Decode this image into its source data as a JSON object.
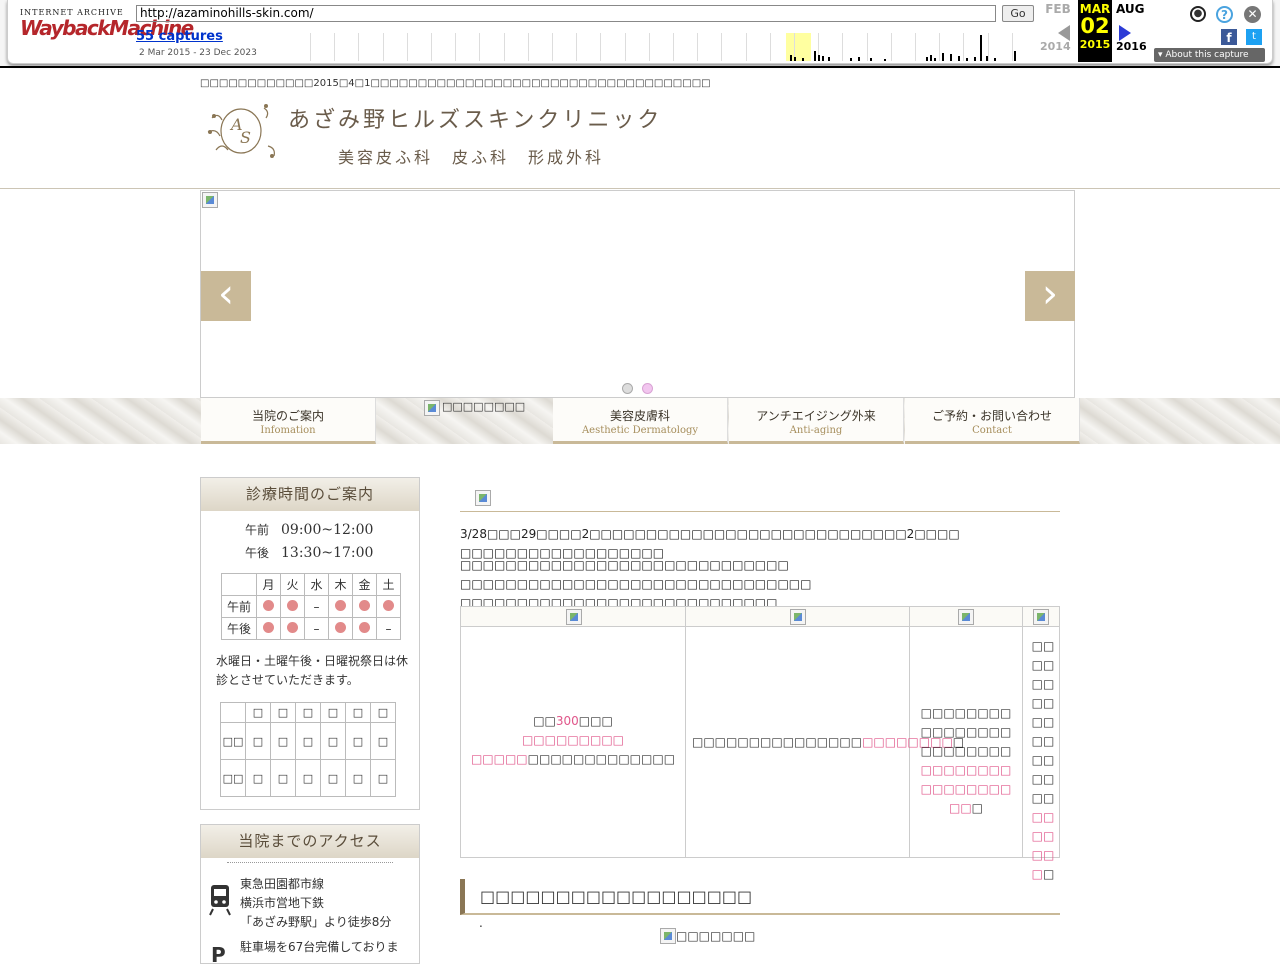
{
  "wayback": {
    "url": "http://azaminohills-skin.com/",
    "go": "Go",
    "captures": "55 captures",
    "range": "2 Mar 2015 - 23 Dec 2023",
    "prev_month": "FEB",
    "prev_year": "2014",
    "cur_month": "MAR",
    "cur_day": "02",
    "cur_year": "2015",
    "next_month": "AUG",
    "next_year": "2016",
    "about": "About this capture",
    "logo_top": "INTERNET ARCHIVE",
    "logo_main": "WaybackMachine"
  },
  "header": {
    "notice": "□□□□□□□□□□□□2015□4□1□□□□□□□□□□□□□□□□□□□□□□□□□□□□□□□□□□□□",
    "clinic_name": "あざみ野ヒルズスキンクリニック",
    "clinic_sub": "美容皮ふ科　皮ふ科　形成外科"
  },
  "nav": {
    "items": [
      {
        "jp": "当院のご案内",
        "en": "Infomation"
      },
      {
        "jp": "",
        "en": "",
        "broken_label": "□□□□□□□□"
      },
      {
        "jp": "美容皮膚科",
        "en": "Aesthetic Dermatology"
      },
      {
        "jp": "アンチエイジング外来",
        "en": "Anti-aging"
      },
      {
        "jp": "ご予約・お問い合わせ",
        "en": "Contact"
      }
    ]
  },
  "sidebar": {
    "hours_title": "診療時間のご案内",
    "am_label": "午前",
    "am_time": "09:00~12:00",
    "pm_label": "午後",
    "pm_time": "13:30~17:00",
    "days": [
      "月",
      "火",
      "水",
      "木",
      "金",
      "土"
    ],
    "row_am": "午前",
    "row_pm": "午後",
    "closed_note": "水曜日・土曜午後・日曜祝祭日は休診とさせていただきます。",
    "sched2_head": [
      "□",
      "□",
      "□",
      "□",
      "□",
      "□"
    ],
    "sched2_row1": [
      "□□",
      "□",
      "□",
      "□",
      "□",
      "□",
      "□"
    ],
    "sched2_row2": [
      "□□",
      "□",
      "□",
      "□",
      "□",
      "□",
      "□"
    ],
    "access_title": "当院までのアクセス",
    "train_1": "東急田園都市線",
    "train_2": "横浜市営地下鉄",
    "train_3": "「あざみ野駅」より徒歩8分",
    "parking": "駐車場を67台完備しておりま"
  },
  "content": {
    "para1": "3/28□□□29□□□□2□□□□□□□□□□□□□□□□□□□□□□□□□□□□2□□□□ □□□□□□□□□□□□□□□□□□",
    "para2": "□□□□□□□□□□□□□□□□□□□□□□□□□□□□□ □□□□□□□□□□□□□□□□□□□□□□□□□□□□□□□ □□□□□□□□□□□□□□□□□□□□□□□□□□□□",
    "cell1_pre": "□□",
    "cell1_num": "300",
    "cell1_post": "□□□",
    "cell1_pink1": "□□□□□□□□□",
    "cell1_pink2": "□□□□□",
    "cell1_rest": "□□□□□□□□□□□□□",
    "cell2_pre": "□□□□□□□□□□□□□□□",
    "cell2_pink": "□□□□□□□□",
    "cell2_post": "□",
    "cell3_pre": "□□□□□□□□□□□□□□□□□□□□□□□□",
    "cell3_pink": "□□□□□□□□□□□□□□□□□□",
    "cell3_post": "□",
    "cell4_pre": "□□□□□□□□□□□□□□□□□□",
    "cell4_pink": "□□□□□□□",
    "cell4_post": "□",
    "section_title": "□□□□□□□□□□□□□□□□□□",
    "dot": ".",
    "img_alt": "□□□□□□□"
  },
  "colors": {
    "accent": "#c9b998",
    "pink": "#e0568a",
    "title": "#6a5c4b"
  }
}
